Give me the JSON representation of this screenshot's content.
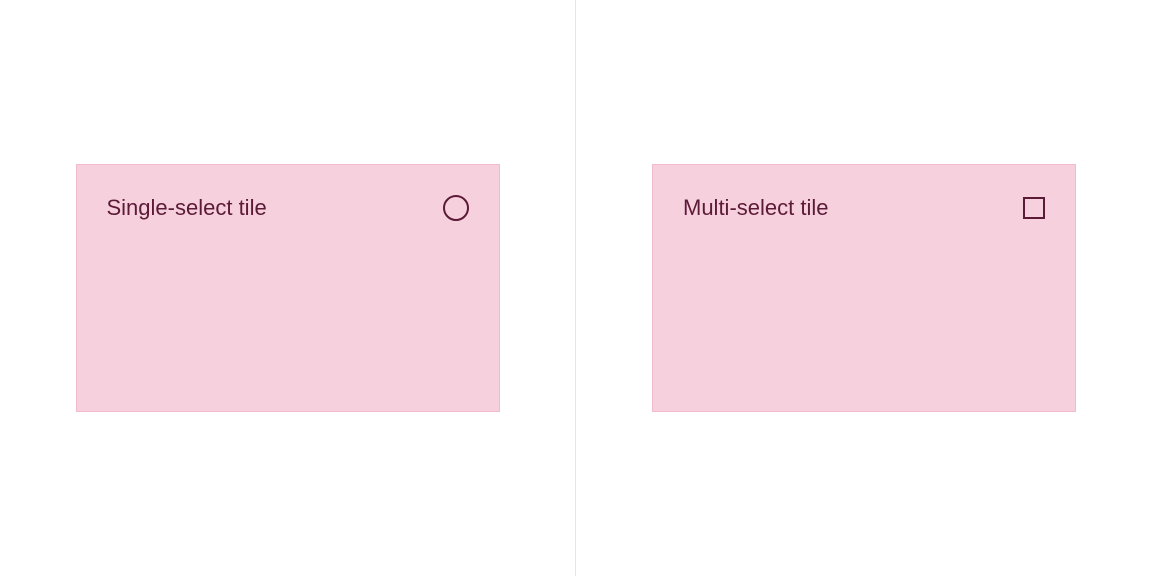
{
  "tiles": {
    "single": {
      "label": "Single-select tile",
      "selected": false
    },
    "multi": {
      "label": "Multi-select tile",
      "selected": false
    }
  },
  "colors": {
    "tile_bg": "#f7d0dd",
    "tile_border": "#f3bacf",
    "text": "#5b1a36",
    "divider": "#e5e5e5"
  }
}
